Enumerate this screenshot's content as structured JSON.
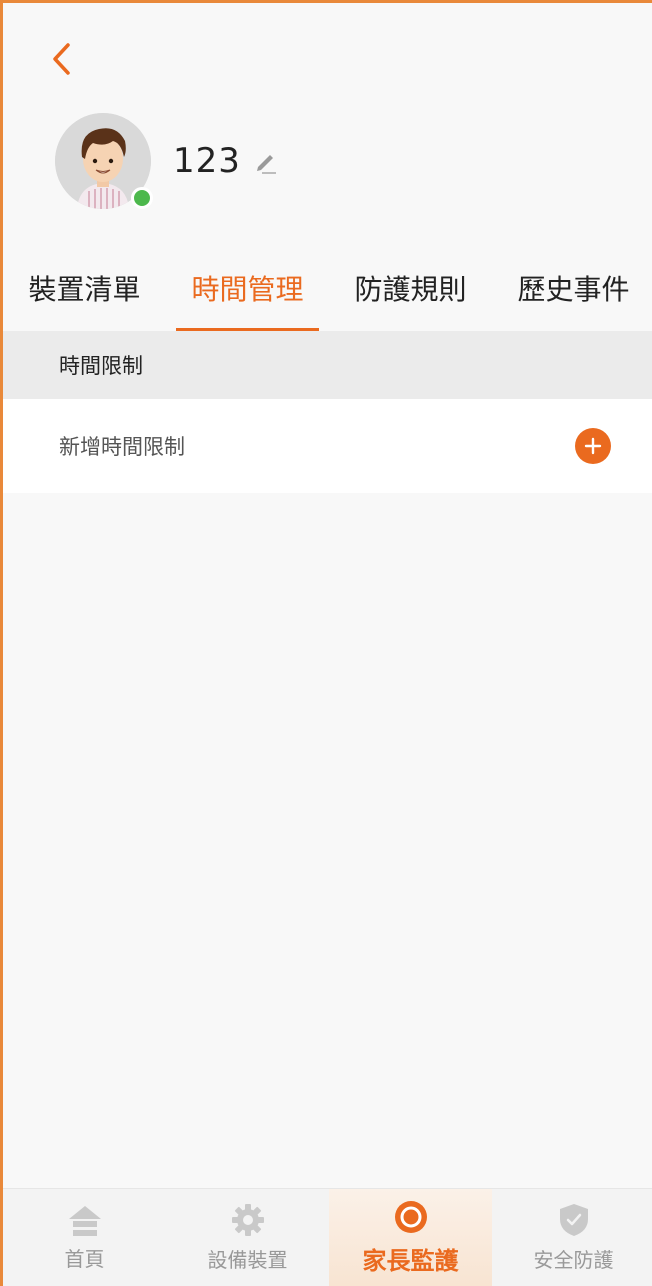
{
  "profile": {
    "name": "123"
  },
  "tabs": [
    {
      "label": "裝置清單"
    },
    {
      "label": "時間管理"
    },
    {
      "label": "防護規則"
    },
    {
      "label": "歷史事件"
    }
  ],
  "section": {
    "title": "時間限制"
  },
  "add_row": {
    "label": "新增時間限制"
  },
  "bottom_nav": [
    {
      "label": "首頁",
      "icon": "home-icon"
    },
    {
      "label": "設備裝置",
      "icon": "gear-icon"
    },
    {
      "label": "家長監護",
      "icon": "parental-control-icon"
    },
    {
      "label": "安全防護",
      "icon": "shield-icon"
    }
  ],
  "colors": {
    "accent": "#ea6a1f",
    "online": "#4cb84c"
  }
}
